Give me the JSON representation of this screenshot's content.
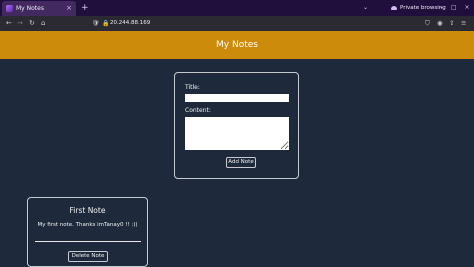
{
  "browser": {
    "tab": {
      "title": "My Notes",
      "close_glyph": "×",
      "favicon": "notes-favicon"
    },
    "new_tab_glyph": "+",
    "tab_menu_glyph": "⌄",
    "private_label": "Private browsing",
    "window_glyphs": "– □ ×",
    "nav": {
      "back": "←",
      "forward": "→",
      "reload": "↻",
      "home": "⌂"
    },
    "url": {
      "text": "20.244.88.169",
      "shield": "🛡",
      "lock": "🔒"
    },
    "toolbar_glyphs": [
      "⛉",
      "◉",
      "⇪",
      "≡"
    ]
  },
  "app": {
    "title": "My Notes",
    "header_color": "#cd8b0c",
    "background": "#1e2a3b"
  },
  "form": {
    "title_label": "Title:",
    "title_value": "",
    "content_label": "Content:",
    "content_value": "",
    "add_button": "Add Note"
  },
  "notes": [
    {
      "title": "First Note",
      "content": "My first note. Thanks imTanay0 !! :))",
      "delete_button": "Delete Note"
    }
  ]
}
